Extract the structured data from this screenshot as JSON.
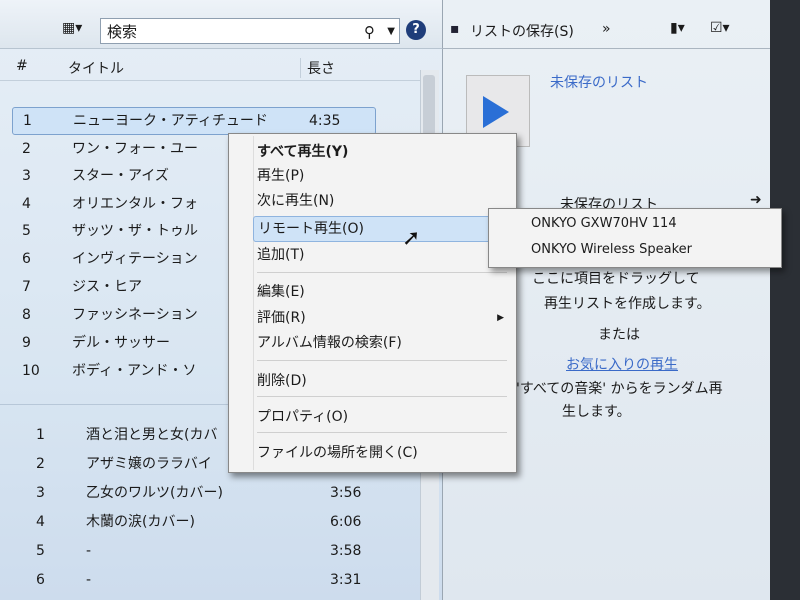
{
  "toolbar": {
    "search_placeholder": "検索",
    "save_list": "リストの保存(S)",
    "more": "»"
  },
  "columns": {
    "num": "#",
    "title": "タイトル",
    "length": "長さ"
  },
  "album1": [
    {
      "n": "1",
      "t": "ニューヨーク・アティチュード",
      "l": "4:35"
    },
    {
      "n": "2",
      "t": "ワン・フォー・ユー",
      "l": ""
    },
    {
      "n": "3",
      "t": "スター・アイズ",
      "l": ""
    },
    {
      "n": "4",
      "t": "オリエンタル・フォ",
      "l": ""
    },
    {
      "n": "5",
      "t": "ザッツ・ザ・トゥル",
      "l": ""
    },
    {
      "n": "6",
      "t": "インヴィテーション",
      "l": ""
    },
    {
      "n": "7",
      "t": "ジス・ヒア",
      "l": ""
    },
    {
      "n": "8",
      "t": "ファッシネーション",
      "l": ""
    },
    {
      "n": "9",
      "t": "デル・サッサー",
      "l": ""
    },
    {
      "n": "10",
      "t": "ボディ・アンド・ソ",
      "l": ""
    }
  ],
  "album2": [
    {
      "n": "1",
      "t": "酒と泪と男と女(カバ",
      "l": ""
    },
    {
      "n": "2",
      "t": "アザミ嬢のララバイ",
      "l": ""
    },
    {
      "n": "3",
      "t": "乙女のワルツ(カバー)",
      "l": "3:56"
    },
    {
      "n": "4",
      "t": "木蘭の涙(カバー)",
      "l": "6:06"
    },
    {
      "n": "5",
      "t": "-",
      "l": "3:58"
    },
    {
      "n": "6",
      "t": "-",
      "l": "3:31"
    }
  ],
  "menu": {
    "play_all": "すべて再生(Y)",
    "play": "再生(P)",
    "play_next": "次に再生(N)",
    "remote_play": "リモート再生(O)",
    "add": "追加(T)",
    "edit": "編集(E)",
    "rate": "評価(R)",
    "find_album": "アルバム情報の検索(F)",
    "delete": "削除(D)",
    "properties": "プロパティ(O)",
    "open_location": "ファイルの場所を開く(C)"
  },
  "submenu": [
    "ONKYO GXW70HV 114",
    "ONKYO Wireless Speaker"
  ],
  "right": {
    "unsaved": "未保存のリスト",
    "unsaved2": "未保存のリスト",
    "drag1": "ここに項目をドラッグして",
    "drag2": "再生リストを作成します。",
    "or": "または",
    "fav": "お気に入りの再生",
    "random1": "'すべての音楽' からをランダム再",
    "random2": "生します。"
  }
}
